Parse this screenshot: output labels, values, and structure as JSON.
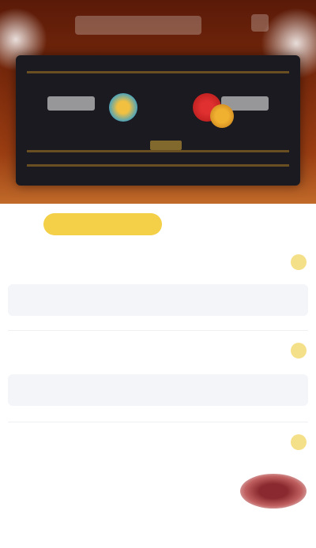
{
  "hero": {
    "title": "",
    "team_left": "",
    "team_right": "",
    "score": ""
  },
  "tabs": [
    {
      "label": ""
    },
    {
      "label": ""
    },
    {
      "label": ""
    }
  ],
  "sections": [
    {
      "title": "",
      "cells": [
        "",
        "",
        "",
        ""
      ]
    },
    {
      "title": "",
      "cells": [
        "",
        "",
        "",
        "",
        ""
      ]
    },
    {
      "title": ""
    }
  ],
  "card": {
    "title": "",
    "sub": ""
  },
  "colors": {
    "accent": "#f3d048",
    "hero_dark": "#5a1a08",
    "hero_light": "#c06a2a",
    "scoreboard": "#1a1a20"
  },
  "icons": [
    "team-logo-icon",
    "team-logo-icon",
    "badge-icon"
  ]
}
